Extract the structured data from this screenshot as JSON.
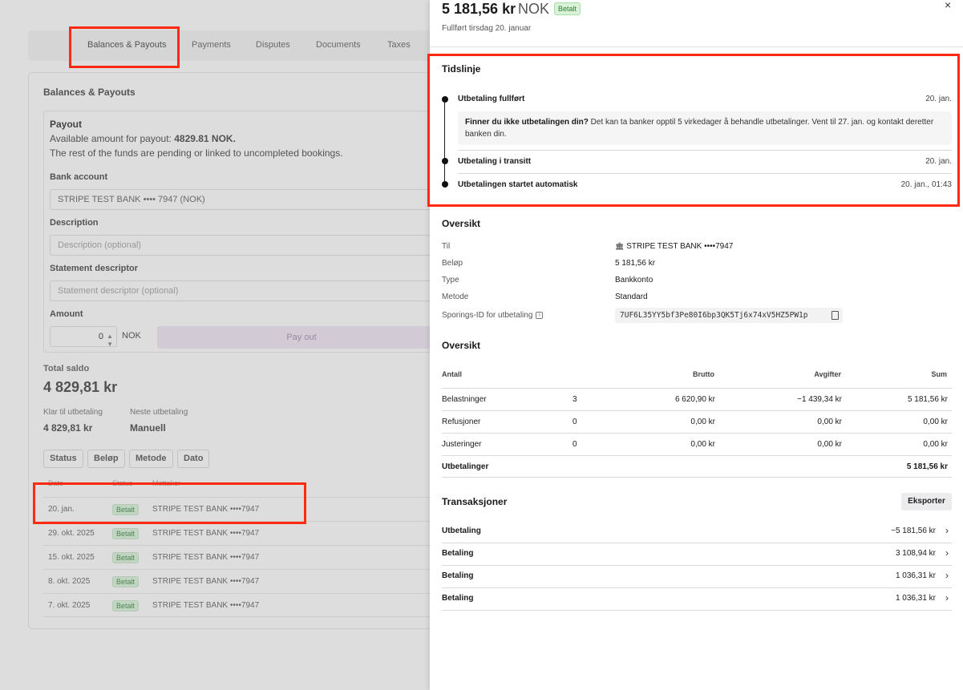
{
  "background": {
    "tabs": [
      "Balances & Payouts",
      "Payments",
      "Disputes",
      "Documents",
      "Taxes"
    ],
    "section_title": "Balances & Payouts",
    "payout": {
      "title": "Payout",
      "available_prefix": "Available amount for payout: ",
      "available_amount": "4829.81 NOK.",
      "pending_text": "The rest of the funds are pending or linked to uncompleted bookings.",
      "bank_account_label": "Bank account",
      "bank_account_value": "STRIPE TEST BANK •••• 7947 (NOK)",
      "description_label": "Description",
      "description_placeholder": "Description (optional)",
      "statement_label": "Statement descriptor",
      "statement_placeholder": "Statement descriptor (optional)",
      "amount_label": "Amount",
      "amount_value": "0",
      "amount_currency": "NOK",
      "payout_button": "Pay out"
    },
    "total_label": "Total saldo",
    "total_value": "4 829,81 kr",
    "ready_label": "Klar til utbetaling",
    "ready_value": "4 829,81 kr",
    "next_label": "Neste utbetaling",
    "next_value": "Manuell",
    "filters": [
      "Status",
      "Beløp",
      "Metode",
      "Dato"
    ],
    "list_columns": [
      "Dato",
      "Status",
      "Mottaker"
    ],
    "payouts": [
      {
        "date": "20. jan.",
        "status": "Betalt",
        "bank": "STRIPE TEST BANK ••••7947"
      },
      {
        "date": "29. okt. 2025",
        "status": "Betalt",
        "bank": "STRIPE TEST BANK ••••7947"
      },
      {
        "date": "15. okt. 2025",
        "status": "Betalt",
        "bank": "STRIPE TEST BANK ••••7947"
      },
      {
        "date": "8. okt. 2025",
        "status": "Betalt",
        "bank": "STRIPE TEST BANK ••••7947"
      },
      {
        "date": "7. okt. 2025",
        "status": "Betalt",
        "bank": "STRIPE TEST BANK ••••7947"
      }
    ]
  },
  "drawer": {
    "amount": "5 181,56 kr",
    "currency": "NOK",
    "status_badge": "Betalt",
    "subtitle": "Fullført tirsdag 20. januar",
    "close_glyph": "×",
    "timeline": {
      "title": "Tidslinje",
      "events": [
        {
          "title": "Utbetaling fullført",
          "date": "20. jan."
        },
        {
          "title": "Utbetaling i transitt",
          "date": "20. jan."
        },
        {
          "title": "Utbetalingen startet automatisk",
          "date": "20. jan., 01:43"
        }
      ],
      "note_bold": "Finner du ikke utbetalingen din?",
      "note_text": " Det kan ta banker opptil 5 virkedager å behandle utbetalinger. Vent til 27. jan. og kontakt deretter banken din."
    },
    "overview": {
      "title": "Oversikt",
      "rows": [
        {
          "label": "Til",
          "value": "STRIPE TEST BANK ••••7947",
          "icon": "bank-icon"
        },
        {
          "label": "Beløp",
          "value": "5 181,56 kr"
        },
        {
          "label": "Type",
          "value": "Bankkonto"
        },
        {
          "label": "Metode",
          "value": "Standard"
        }
      ],
      "trace_label": "Sporings-ID for utbetaling",
      "trace_id": "7UF6L35YY5bf3Pe80I6bp3QK5Tj6x74xV5HZ5PW1p"
    },
    "summary": {
      "title": "Oversikt",
      "headers": [
        "Antall",
        "Brutto",
        "Avgifter",
        "Sum"
      ],
      "rows": [
        {
          "label": "Belastninger",
          "count": "3",
          "gross": "6 620,90 kr",
          "fees": "−1 439,34 kr",
          "sum": "5 181,56 kr"
        },
        {
          "label": "Refusjoner",
          "count": "0",
          "gross": "0,00 kr",
          "fees": "0,00 kr",
          "sum": "0,00 kr"
        },
        {
          "label": "Justeringer",
          "count": "0",
          "gross": "0,00 kr",
          "fees": "0,00 kr",
          "sum": "0,00 kr"
        }
      ],
      "total_label": "Utbetalinger",
      "total_sum": "5 181,56 kr"
    },
    "transactions": {
      "title": "Transaksjoner",
      "export_label": "Eksporter",
      "rows": [
        {
          "label": "Utbetaling",
          "amount": "−5 181,56 kr"
        },
        {
          "label": "Betaling",
          "amount": "3 108,94 kr"
        },
        {
          "label": "Betaling",
          "amount": "1 036,31 kr"
        },
        {
          "label": "Betaling",
          "amount": "1 036,31 kr"
        }
      ]
    }
  },
  "colors": {
    "highlight": "#ff2a10",
    "paid_badge_bg": "#d8f3d8",
    "paid_badge_text": "#2e7d32",
    "payout_button_bg": "#efe3f3"
  }
}
